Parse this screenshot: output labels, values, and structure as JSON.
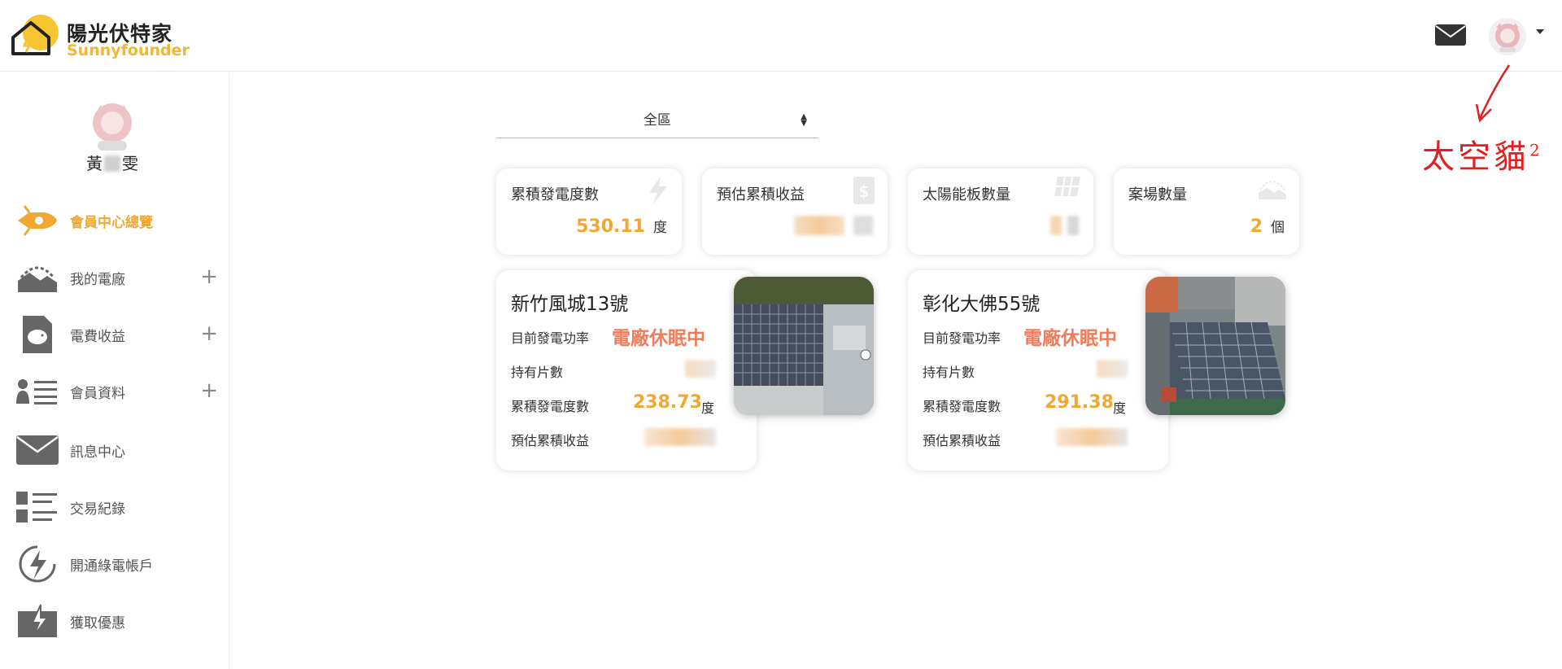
{
  "app": {
    "name": "陽光伏特家",
    "sub": "Sunnyfounder"
  },
  "user": {
    "name_first": "黃",
    "name_last": "雯"
  },
  "annotation": {
    "text": "太空貓",
    "sup": "2"
  },
  "sidebar": {
    "items": [
      {
        "label": "會員中心總覽",
        "icon": "rocket-icon",
        "expandable": false,
        "active": true
      },
      {
        "label": "我的電廠",
        "icon": "solar-house-icon",
        "expandable": true
      },
      {
        "label": "電費收益",
        "icon": "piggy-bank-icon",
        "expandable": true
      },
      {
        "label": "會員資料",
        "icon": "member-list-icon",
        "expandable": true
      },
      {
        "label": "訊息中心",
        "icon": "mail-icon",
        "expandable": false
      },
      {
        "label": "交易紀錄",
        "icon": "transaction-list-icon",
        "expandable": false
      },
      {
        "label": "開通綠電帳戶",
        "icon": "green-power-icon",
        "expandable": false
      },
      {
        "label": "獲取優惠",
        "icon": "coupon-icon",
        "expandable": false
      }
    ],
    "plus": "+"
  },
  "filter": {
    "region": "全區"
  },
  "stats": [
    {
      "title": "累積發電度數",
      "value": "530.11",
      "unit": "度",
      "icon": "lightning-icon"
    },
    {
      "title": "預估累積收益",
      "value": "",
      "unit": "",
      "icon": "dollar-icon"
    },
    {
      "title": "太陽能板數量",
      "value": "",
      "unit": "",
      "icon": "solar-panel-icon"
    },
    {
      "title": "案場數量",
      "value": "2",
      "unit": "個",
      "icon": "site-icon"
    }
  ],
  "plants": [
    {
      "name": "新竹風城13號",
      "power_label": "目前發電功率",
      "status": "電廠休眠中",
      "panels_label": "持有片數",
      "energy_label": "累積發電度數",
      "energy": "238.73",
      "energy_unit": "度",
      "revenue_label": "預估累積收益"
    },
    {
      "name": "彰化大佛55號",
      "power_label": "目前發電功率",
      "status": "電廠休眠中",
      "panels_label": "持有片數",
      "energy_label": "累積發電度數",
      "energy": "291.38",
      "energy_unit": "度",
      "revenue_label": "預估累積收益"
    }
  ],
  "colors": {
    "brand": "#f2b632",
    "accent": "#f0a830",
    "status": "#f07c5c",
    "annotation": "#e02020"
  }
}
